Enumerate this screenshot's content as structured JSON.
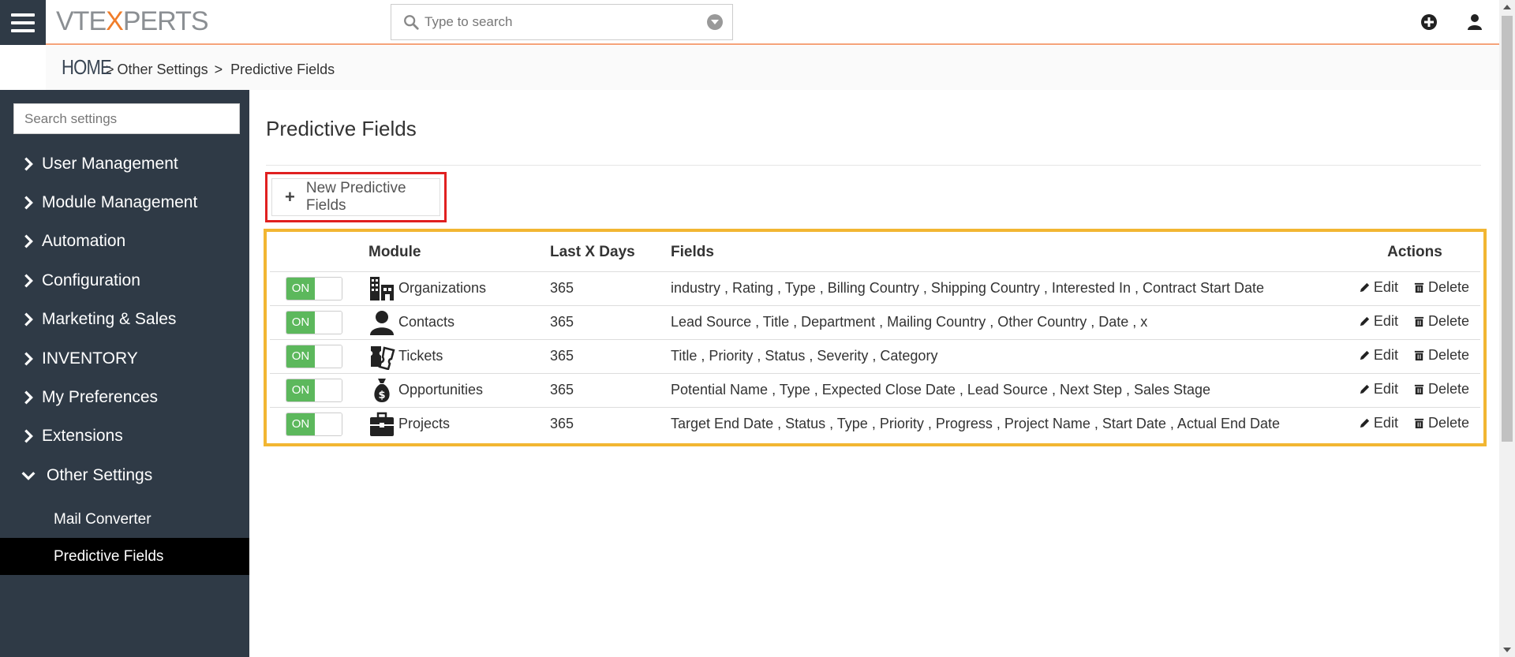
{
  "header": {
    "logo_left": "VTE",
    "logo_x": "X",
    "logo_right": "PERTS",
    "search_placeholder": "Type to search",
    "icons": [
      "menu-icon",
      "search-icon",
      "chevron-down-icon",
      "plus-circle-icon",
      "user-icon"
    ]
  },
  "breadcrumb": {
    "home": "HOME",
    "sep": ">",
    "items": [
      "Other Settings",
      "Predictive Fields"
    ]
  },
  "sidebar": {
    "search_placeholder": "Search settings",
    "items": [
      {
        "label": "User Management",
        "icon": "chevron-right-icon"
      },
      {
        "label": "Module Management",
        "icon": "chevron-right-icon"
      },
      {
        "label": "Automation",
        "icon": "chevron-right-icon"
      },
      {
        "label": "Configuration",
        "icon": "chevron-right-icon"
      },
      {
        "label": "Marketing & Sales",
        "icon": "chevron-right-icon"
      },
      {
        "label": "INVENTORY",
        "icon": "chevron-right-icon"
      },
      {
        "label": "My Preferences",
        "icon": "chevron-right-icon"
      },
      {
        "label": "Extensions",
        "icon": "chevron-right-icon"
      },
      {
        "label": "Other Settings",
        "icon": "chevron-down-icon"
      }
    ],
    "subitems": [
      {
        "label": "Mail Converter",
        "active": false
      },
      {
        "label": "Predictive Fields",
        "active": true
      }
    ]
  },
  "main": {
    "title": "Predictive Fields",
    "new_button": "New Predictive Fields",
    "table": {
      "headers": [
        "Module",
        "Last X Days",
        "Fields",
        "Actions"
      ],
      "edit_label": "Edit",
      "delete_label": "Delete",
      "toggle_on": "ON",
      "rows": [
        {
          "module": "Organizations",
          "icon": "organizations-icon",
          "days": "365",
          "fields": "industry , Rating , Type , Billing Country , Shipping Country , Interested In , Contract Start Date"
        },
        {
          "module": "Contacts",
          "icon": "contacts-icon",
          "days": "365",
          "fields": "Lead Source , Title , Department , Mailing Country , Other Country , Date , x"
        },
        {
          "module": "Tickets",
          "icon": "tickets-icon",
          "days": "365",
          "fields": "Title , Priority , Status , Severity , Category"
        },
        {
          "module": "Opportunities",
          "icon": "opportunities-icon",
          "days": "365",
          "fields": "Potential Name , Type , Expected Close Date , Lead Source , Next Step , Sales Stage"
        },
        {
          "module": "Projects",
          "icon": "projects-icon",
          "days": "365",
          "fields": "Target End Date , Status , Type , Priority , Progress , Project Name , Start Date , Actual End Date"
        }
      ]
    }
  },
  "colors": {
    "sidebar_bg": "#2f3a46",
    "active_item_bg": "#000000",
    "toggle_on": "#5cb85c",
    "highlight_new_button": "#e02020",
    "highlight_table": "#f2b632",
    "accent_orange": "#f07d2a"
  }
}
